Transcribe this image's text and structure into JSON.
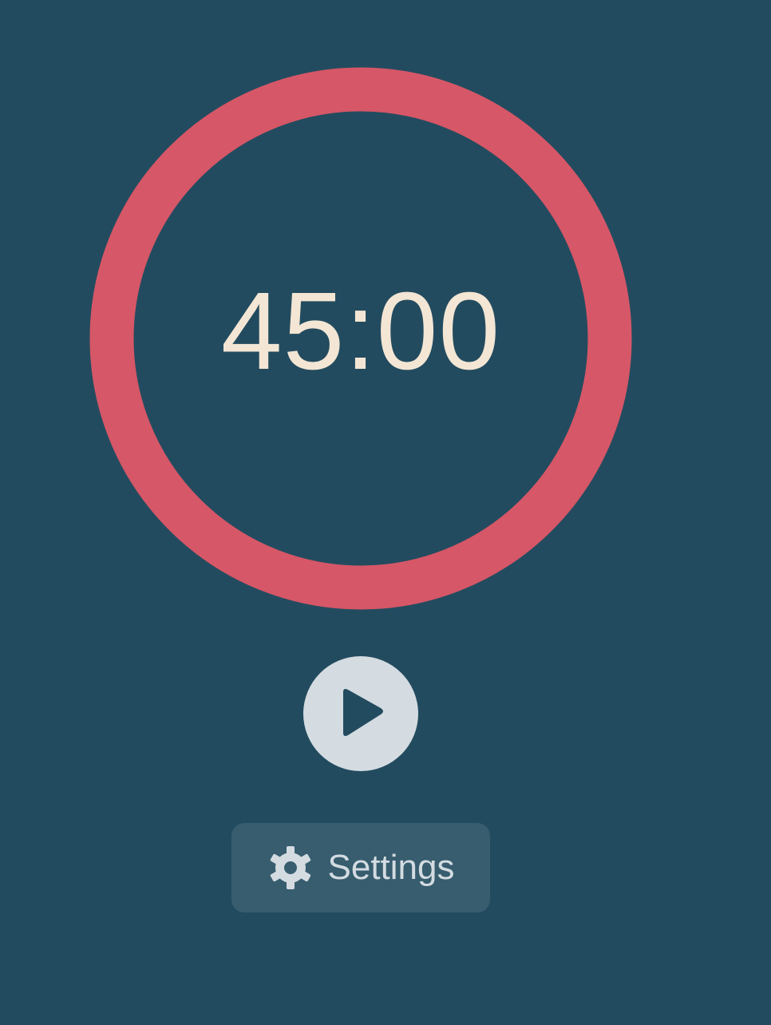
{
  "timer": {
    "time": "45:00",
    "progress": 1.0
  },
  "controls": {
    "play_icon": "play-icon"
  },
  "settings": {
    "label": "Settings",
    "icon": "gear-icon"
  },
  "colors": {
    "background": "#234b5f",
    "ring": "#d65767",
    "time_text": "#f3e6d4",
    "play_button": "#d4dce1",
    "settings_button": "#375d6f"
  }
}
